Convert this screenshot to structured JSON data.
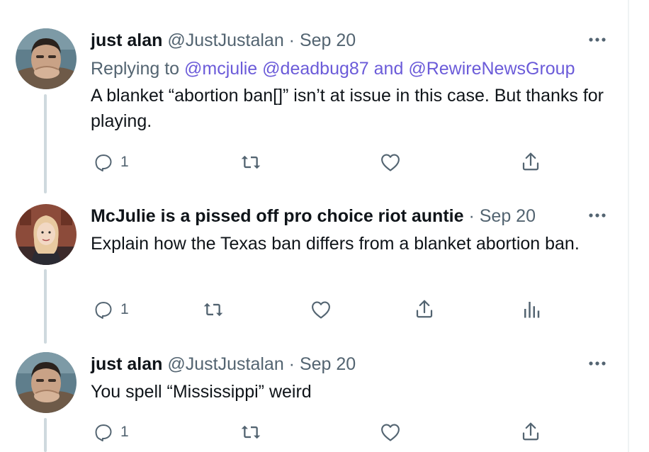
{
  "colors": {
    "text": "#0f1419",
    "secondary": "#536471",
    "mention": "#6b5bd9",
    "thread_line": "#cfd9de"
  },
  "tweets": [
    {
      "display_name": "just alan",
      "handle": "@JustJustalan",
      "separator": "·",
      "date": "Sep 20",
      "replying_prefix": "Replying to",
      "mentions": [
        "@mcjulie",
        "@deadbug87"
      ],
      "and_text": "and",
      "last_mention": "@RewireNewsGroup",
      "text": "A blanket “abortion ban[]” isn’t at issue in this case. But thanks for playing.",
      "reply_count": "1",
      "icons": [
        "reply-icon",
        "retweet-icon",
        "like-icon",
        "share-icon",
        "more-icon"
      ]
    },
    {
      "display_name": "McJulie is a pissed off pro choice riot auntie",
      "separator": "·",
      "date": "Sep 20",
      "text": "Explain how the Texas ban differs from a blanket abortion ban.",
      "reply_count": "1",
      "icons": [
        "reply-icon",
        "retweet-icon",
        "like-icon",
        "share-icon",
        "analytics-icon",
        "more-icon"
      ]
    },
    {
      "display_name": "just alan",
      "handle": "@JustJustalan",
      "separator": "·",
      "date": "Sep 20",
      "text": "You spell “Mississippi” weird",
      "reply_count": "1",
      "icons": [
        "reply-icon",
        "retweet-icon",
        "like-icon",
        "share-icon",
        "more-icon"
      ]
    }
  ]
}
